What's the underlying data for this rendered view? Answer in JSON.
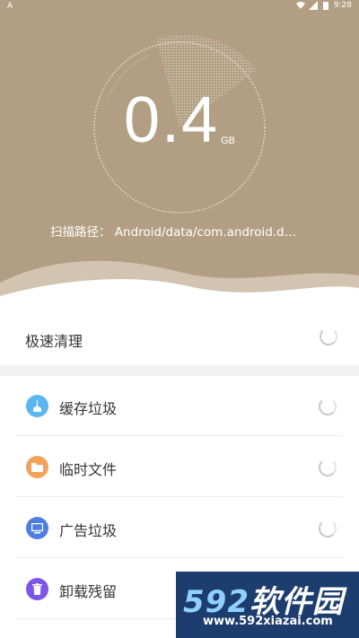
{
  "statusbar": {
    "left_label": "A",
    "time": "9:28"
  },
  "scan": {
    "size_value": "0.4",
    "size_unit": "GB",
    "path_label": "扫描路径：",
    "path_value": "Android/data/com.android.d…"
  },
  "quick_clean": {
    "label": "极速清理"
  },
  "items": [
    {
      "label": "缓存垃圾",
      "icon": "broom-icon",
      "color": "#5ab6ef"
    },
    {
      "label": "临时文件",
      "icon": "folder-icon",
      "color": "#f2a25b"
    },
    {
      "label": "广告垃圾",
      "icon": "screen-icon",
      "color": "#4e7fe0"
    },
    {
      "label": "卸载残留",
      "icon": "trash-icon",
      "color": "#7d55e8"
    }
  ],
  "watermark": {
    "brand_num": "592",
    "brand_text": "软件园",
    "url": "www.592xiazai.com"
  },
  "colors": {
    "header": "#b29f83",
    "divider": "#f2f2f2"
  }
}
